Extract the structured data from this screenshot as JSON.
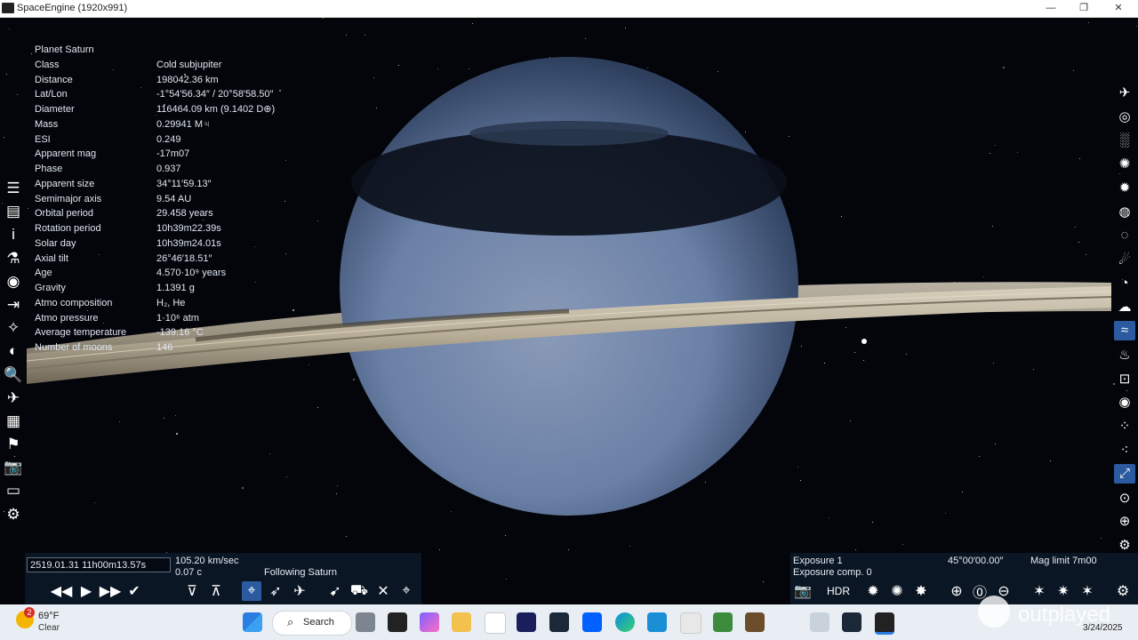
{
  "window": {
    "title": "SpaceEngine (1920x991)",
    "minimize": "—",
    "maximize": "❐",
    "close": "✕"
  },
  "info": {
    "header": "Planet  Saturn",
    "rows": [
      {
        "k": "Class",
        "v": "Cold subjupiter"
      },
      {
        "k": "Distance",
        "v": "198042.36 km"
      },
      {
        "k": "Lat/Lon",
        "v": "-1°54′56.34″ / 20°58′58.50″"
      },
      {
        "k": "Diameter",
        "v": "116464.09 km (9.1402 D⊕)"
      },
      {
        "k": "Mass",
        "v": "0.29941 M♃"
      },
      {
        "k": "ESI",
        "v": "0.249"
      },
      {
        "k": "Apparent mag",
        "v": "-17m07"
      },
      {
        "k": "Phase",
        "v": "0.937"
      },
      {
        "k": "Apparent size",
        "v": "34°11′59.13″"
      },
      {
        "k": "Semimajor axis",
        "v": "9.54 AU"
      },
      {
        "k": "Orbital period",
        "v": "29.458 years"
      },
      {
        "k": "Rotation period",
        "v": "10h39m22.39s"
      },
      {
        "k": "Solar day",
        "v": "10h39m24.01s"
      },
      {
        "k": "Axial tilt",
        "v": "26°46′18.51″"
      },
      {
        "k": "Age",
        "v": "4.570·10⁹ years"
      },
      {
        "k": "Gravity",
        "v": "1.1391 g"
      },
      {
        "k": "Atmo composition",
        "v": "H₂, He"
      },
      {
        "k": "Atmo pressure",
        "v": "1·10⁶ atm"
      },
      {
        "k": "Average temperature",
        "v": "-139.16 °C"
      },
      {
        "k": "Number of moons",
        "v": "146"
      }
    ]
  },
  "left_toolbar": [
    "menu-icon",
    "catalog-icon",
    "info-icon",
    "planetarium-icon",
    "binoculars-icon",
    "orbit-icon",
    "star-map-icon",
    "wiki-icon",
    "search-icon",
    "ship-icon",
    "journal-icon",
    "flag-icon",
    "camera-icon",
    "display-icon",
    "settings-icon"
  ],
  "left_glyphs": [
    "☰",
    "▤",
    "i",
    "⚗",
    "◉",
    "⇥",
    "✧",
    "◐",
    "🔍",
    "✈",
    "▦",
    "⚑",
    "📷",
    "▭",
    "⚙"
  ],
  "right_toolbar": [
    "spaceship-icon",
    "galaxy-icon",
    "nebula-icon",
    "star-cluster-icon",
    "star-icon",
    "planet-icon",
    "rings-icon",
    "comet-icon",
    "asteroid-icon",
    "cloud-icon",
    "water-icon",
    "aurora-icon",
    "constellation-icon",
    "eye-icon",
    "orbits-icon",
    "labels-icon",
    "expand-icon",
    "target-icon",
    "grid-icon",
    "settings-icon"
  ],
  "right_glyphs": [
    "✈",
    "◎",
    "░",
    "✺",
    "✹",
    "◍",
    "◌",
    "☄",
    "◔",
    "☁",
    "≈",
    "♨",
    "⊡",
    "◉",
    "⁘",
    "⁖",
    "⤢",
    "⊙",
    "⊕",
    "⚙"
  ],
  "right_hl": [
    false,
    false,
    false,
    false,
    false,
    false,
    false,
    false,
    false,
    false,
    true,
    false,
    false,
    false,
    false,
    false,
    true,
    false,
    false,
    false
  ],
  "bottom": {
    "date": "2519.01.31 11h00m13.57s",
    "speed": "105.20 km/sec",
    "speed_c": "0.07 c",
    "status": "Following Saturn",
    "exposure": "Exposure 1",
    "exposure_comp": "Exposure comp. 0",
    "fov": "45°00′00.00″",
    "mag_limit": "Mag limit 7m00",
    "hdr": "HDR"
  },
  "taskbar": {
    "temp": "69°F",
    "weather": "Clear",
    "search": "Search",
    "badge": "2",
    "watermark": "outplayed",
    "date": "3/24/2025"
  },
  "colors": {
    "accent": "#2b5aa0",
    "panel": "#0b1624",
    "text": "#dfe6f2"
  }
}
